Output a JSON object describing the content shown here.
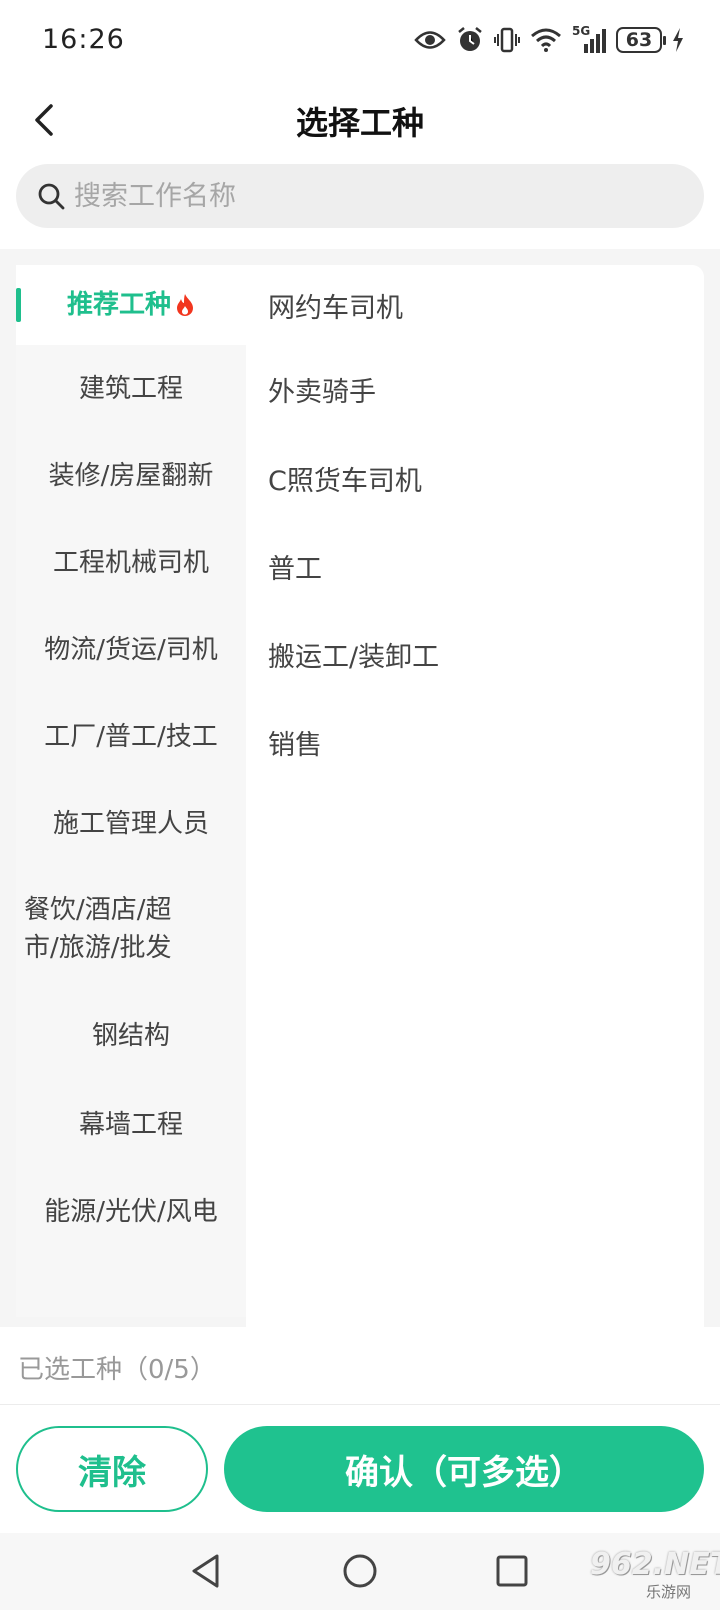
{
  "status_bar": {
    "time": "16:26",
    "network_label": "5G",
    "battery_level": "63"
  },
  "header": {
    "title": "选择工种"
  },
  "search": {
    "placeholder": "搜索工作名称"
  },
  "sidebar": {
    "items": [
      {
        "label": "推荐工种",
        "active": true
      },
      {
        "label": "建筑工程"
      },
      {
        "label": "装修/房屋翻新"
      },
      {
        "label": "工程机械司机"
      },
      {
        "label": "物流/货运/司机"
      },
      {
        "label": "工厂/普工/技工"
      },
      {
        "label": "施工管理人员"
      },
      {
        "label": "餐饮/酒店/超市/旅游/批发"
      },
      {
        "label": "钢结构"
      },
      {
        "label": "幕墙工程"
      },
      {
        "label": "能源/光伏/风电"
      }
    ]
  },
  "jobs": [
    "网约车司机",
    "外卖骑手",
    "C照货车司机",
    "普工",
    "搬运工/装卸工",
    "销售"
  ],
  "selected": {
    "label": "已选工种（0/5）"
  },
  "actions": {
    "clear_label": "清除",
    "confirm_label": "确认（可多选）"
  },
  "watermark": {
    "text": "962.NET",
    "sub": "乐游网"
  },
  "colors": {
    "accent": "#1fbf8d",
    "fire": "#f2361f"
  }
}
